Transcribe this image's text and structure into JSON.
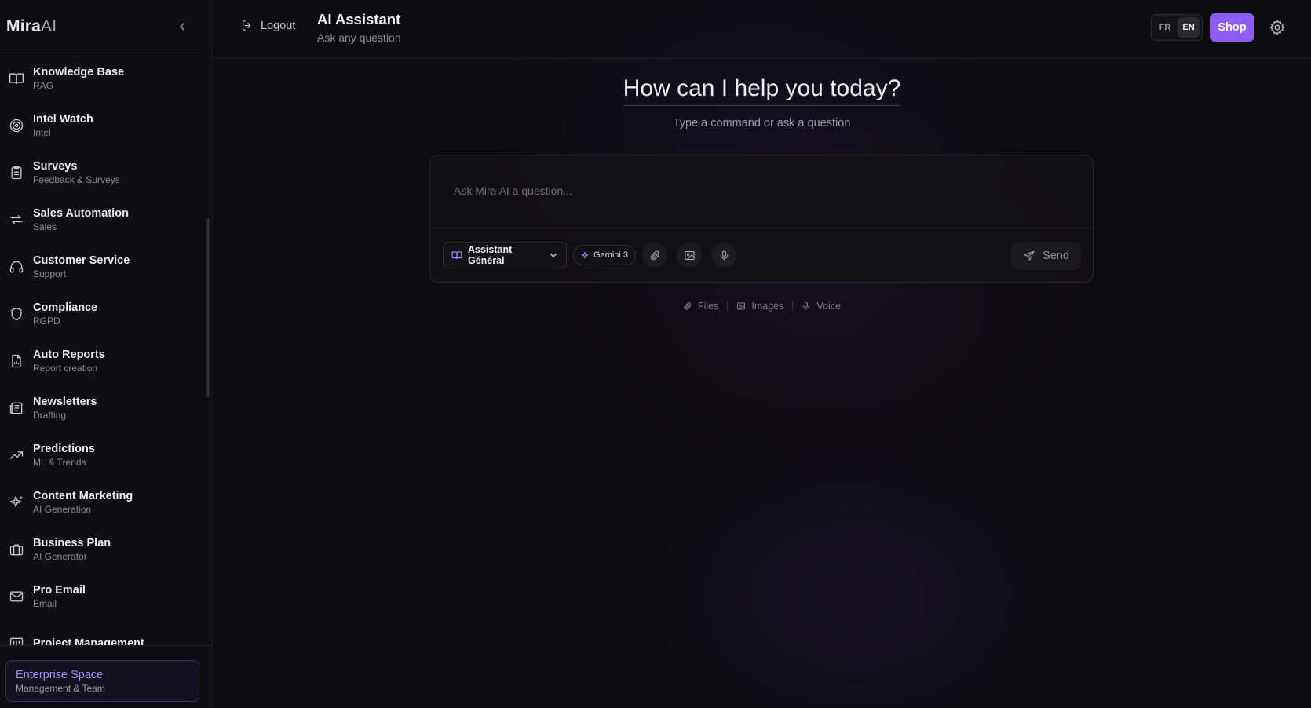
{
  "sidebar": {
    "brand_main": "Mira",
    "brand_ai": "AI",
    "items": [
      {
        "label": "Knowledge Base",
        "sub": "RAG",
        "icon": "book-icon"
      },
      {
        "label": "Intel Watch",
        "sub": "Intel",
        "icon": "target-icon"
      },
      {
        "label": "Surveys",
        "sub": "Feedback & Surveys",
        "icon": "clipboard-icon"
      },
      {
        "label": "Sales Automation",
        "sub": "Sales",
        "icon": "repeat-icon"
      },
      {
        "label": "Customer Service",
        "sub": "Support",
        "icon": "headphones-icon"
      },
      {
        "label": "Compliance",
        "sub": "RGPD",
        "icon": "shield-icon"
      },
      {
        "label": "Auto Reports",
        "sub": "Report creation",
        "icon": "report-icon"
      },
      {
        "label": "Newsletters",
        "sub": "Drafting",
        "icon": "newspaper-icon"
      },
      {
        "label": "Predictions",
        "sub": "ML & Trends",
        "icon": "trending-up-icon"
      },
      {
        "label": "Content Marketing",
        "sub": "AI Generation",
        "icon": "sparkles-icon"
      },
      {
        "label": "Business Plan",
        "sub": "AI Generator",
        "icon": "briefcase-icon"
      },
      {
        "label": "Pro Email",
        "sub": "Email",
        "icon": "mail-icon"
      },
      {
        "label": "Project Management",
        "sub": "",
        "icon": "kanban-icon"
      }
    ],
    "enterprise": {
      "title": "Enterprise Space",
      "sub": "Management & Team"
    }
  },
  "header": {
    "logout_label": "Logout",
    "title": "AI Assistant",
    "subtitle": "Ask any question",
    "lang_options": [
      "FR",
      "EN"
    ],
    "lang_selected": "EN",
    "shop_label": "Shop"
  },
  "hero": {
    "title": "How can I help you today?",
    "subtitle": "Type a command or ask a question"
  },
  "composer": {
    "placeholder": "Ask Mira AI a question...",
    "assistant_label": "Assistant Général",
    "model_label": "Gemini 3",
    "send_label": "Send"
  },
  "hints": [
    "Files",
    "Images",
    "Voice"
  ],
  "colors": {
    "accent": "#8b5cf6",
    "enterprise_text": "#a98cff",
    "background": "#0c0c0e"
  }
}
